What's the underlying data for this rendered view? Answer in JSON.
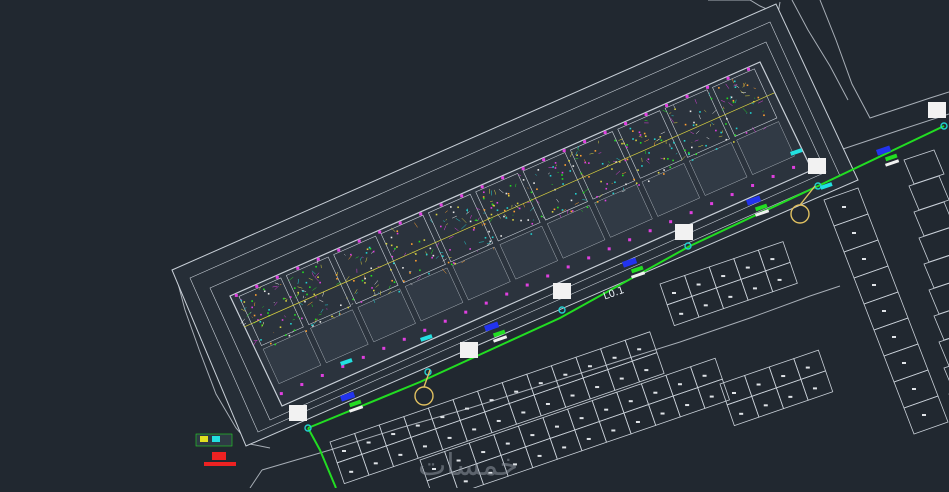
{
  "viewport": {
    "background": "#212830"
  },
  "drawing": {
    "line_label": "L0.1",
    "watermark": "خمسات",
    "colors": {
      "boundary": "#c9d0d8",
      "pipe": "#22dd22",
      "node": "#22d0d0",
      "magenta": "#e040e0",
      "yellow": "#d8d040",
      "marker_blue": "#2233ee",
      "marker_cyan": "#22e0e0",
      "legend_red": "#ee2222"
    },
    "icons": [
      "pipeline-node-icon",
      "tag-marker-icon",
      "legend-icon",
      "circle-callout-icon"
    ]
  }
}
